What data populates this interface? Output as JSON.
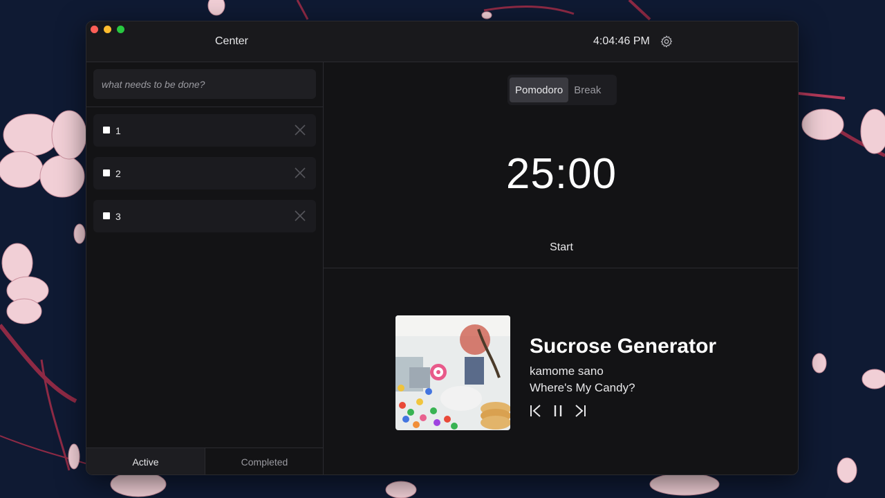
{
  "window": {
    "title": "Center",
    "clock": "4:04:46 PM"
  },
  "tasks": {
    "input_placeholder": "what needs to be done?",
    "items": [
      {
        "label": "1",
        "checked": false
      },
      {
        "label": "2",
        "checked": false
      },
      {
        "label": "3",
        "checked": false
      }
    ],
    "tabs": {
      "active": "Active",
      "completed": "Completed"
    }
  },
  "timer": {
    "modes": [
      "Pomodoro",
      "Break"
    ],
    "selected_mode": "Pomodoro",
    "time": "25:00",
    "start_label": "Start"
  },
  "player": {
    "title": "Sucrose Generator",
    "artist": "kamome sano",
    "album": "Where's My Candy?",
    "icons": [
      "previous-icon",
      "pause-icon",
      "next-icon"
    ]
  },
  "colors": {
    "background": "#0f1a33",
    "window": "#131315",
    "accent_text": "#ffffff",
    "blossom": "#f1cfd6",
    "branch": "#8e2a45"
  }
}
